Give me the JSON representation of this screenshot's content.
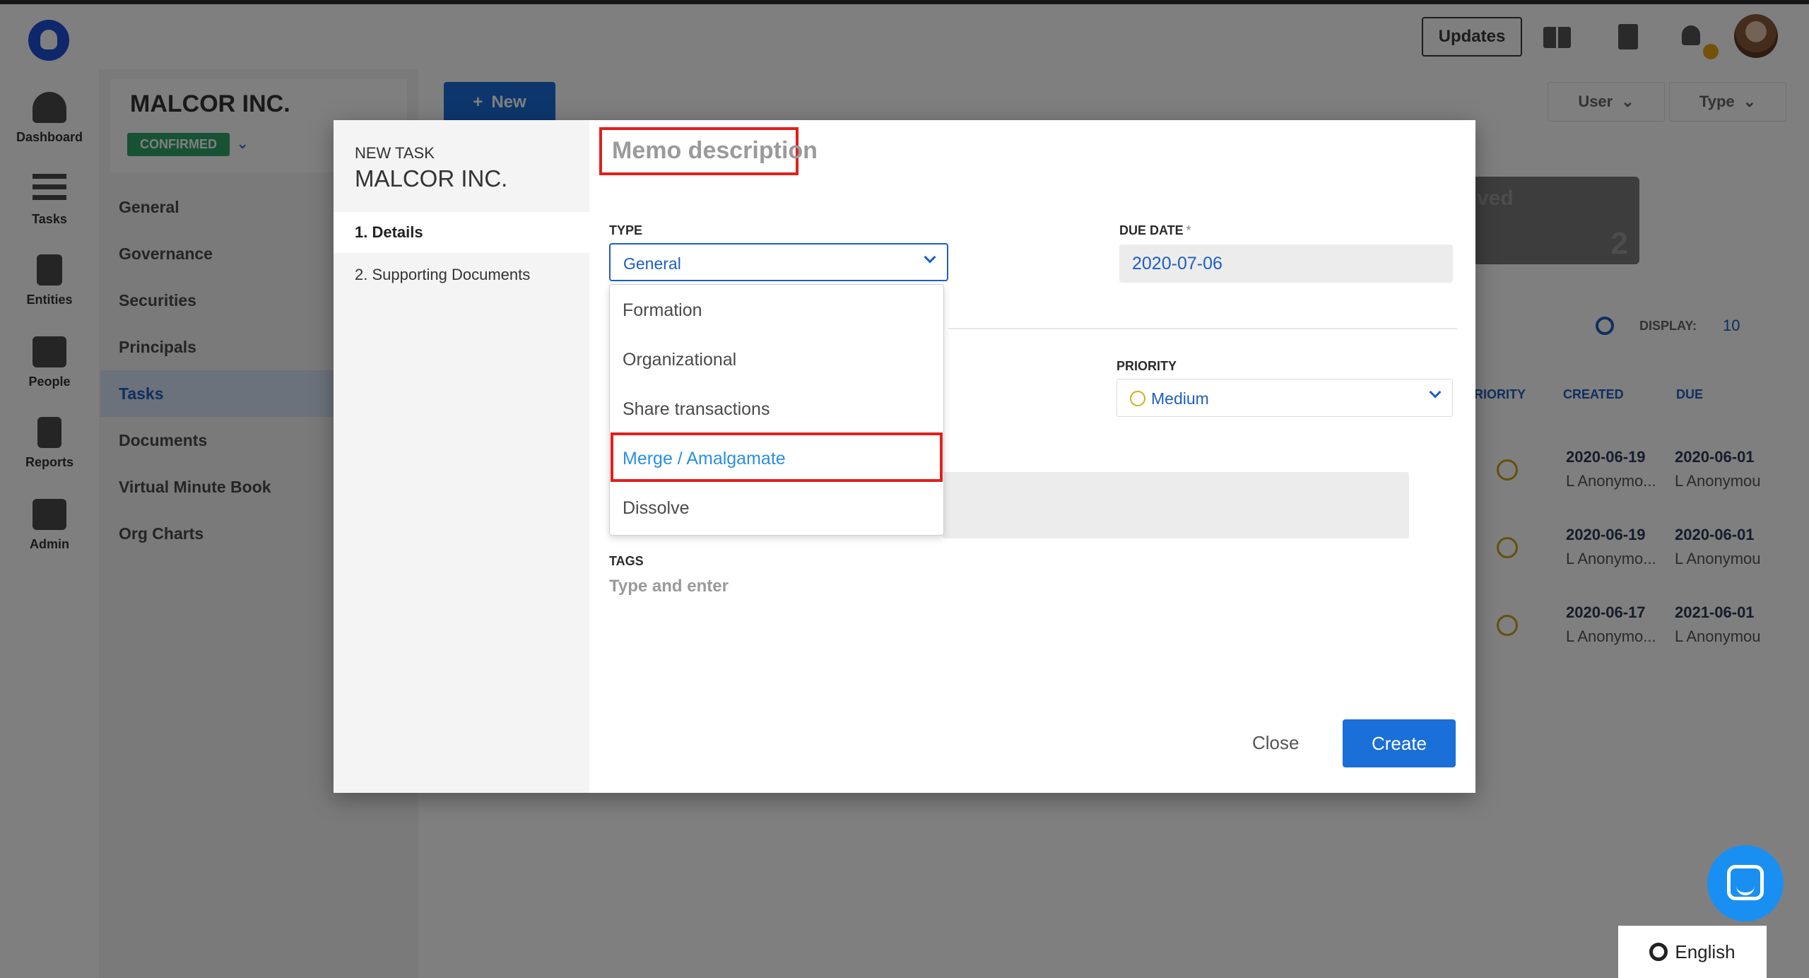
{
  "header": {
    "updates_label": "Updates"
  },
  "sidebar": {
    "items": [
      {
        "label": "Dashboard",
        "icon": "dashboard-icon"
      },
      {
        "label": "Tasks",
        "icon": "tasks-icon"
      },
      {
        "label": "Entities",
        "icon": "building-icon"
      },
      {
        "label": "People",
        "icon": "id-card-icon"
      },
      {
        "label": "Reports",
        "icon": "document-icon"
      },
      {
        "label": "Admin",
        "icon": "copy-icon"
      }
    ]
  },
  "entity": {
    "name": "MALCOR INC.",
    "status": "CONFIRMED"
  },
  "submenu": {
    "items": [
      "General",
      "Governance",
      "Securities",
      "Principals",
      "Tasks",
      "Documents",
      "Virtual Minute Book",
      "Org Charts"
    ],
    "active": "Tasks"
  },
  "toolbar": {
    "new_label": "New",
    "user_filter": "User",
    "type_filter": "Type"
  },
  "stat_card": {
    "label": "ved",
    "value": "2"
  },
  "table": {
    "display_label": "DISPLAY:",
    "display_value": "10",
    "headers": [
      "RIORITY",
      "CREATED",
      "DUE"
    ],
    "rows": [
      {
        "created": "2020-06-19",
        "created_by": "L Anonymo...",
        "due": "2020-06-01",
        "due_by": "L Anonymou"
      },
      {
        "created": "2020-06-19",
        "created_by": "L Anonymo...",
        "due": "2020-06-01",
        "due_by": "L Anonymou"
      },
      {
        "created": "2020-06-17",
        "created_by": "L Anonymo...",
        "due": "2021-06-01",
        "due_by": "L Anonymou"
      }
    ]
  },
  "modal": {
    "new_task_label": "NEW TASK",
    "company": "MALCOR INC.",
    "steps": [
      "1. Details",
      "2. Supporting Documents"
    ],
    "title": "Memo description",
    "type_label": "TYPE",
    "type_value": "General",
    "due_date_label": "DUE DATE",
    "due_date_required": "*",
    "due_date_value": "2020-07-06",
    "priority_label": "PRIORITY",
    "priority_value": "Medium",
    "tags_label": "TAGS",
    "tags_placeholder": "Type and enter",
    "type_options": [
      "Formation",
      "Organizational",
      "Share transactions",
      "Merge / Amalgamate",
      "Dissolve"
    ],
    "highlighted_option": "Merge / Amalgamate",
    "close_label": "Close",
    "create_label": "Create"
  },
  "language": {
    "label": "English"
  },
  "colors": {
    "primary": "#1a6fd8",
    "highlight": "#e0201b",
    "confirmed": "#2fa56a"
  }
}
